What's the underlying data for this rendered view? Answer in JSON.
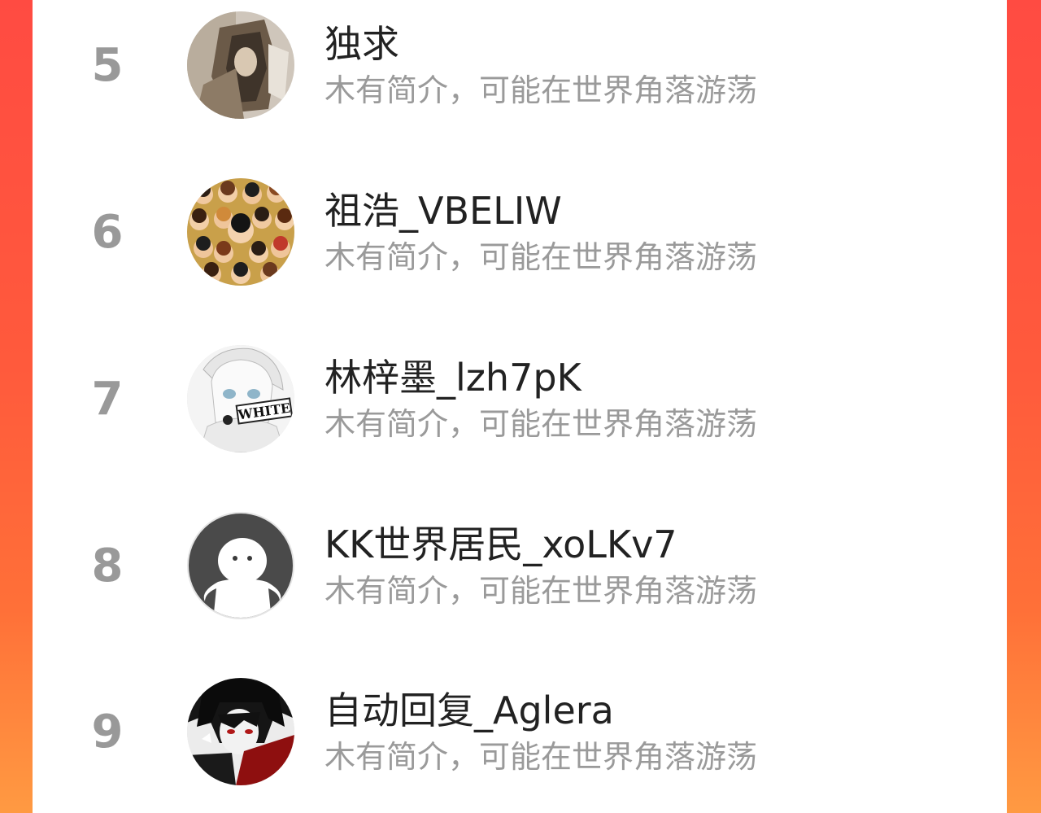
{
  "rank_list": {
    "rows": [
      {
        "rank": "5",
        "name": "独求",
        "bio": "木有简介，可能在世界角落游荡",
        "avatar_icon": "sketch-portrait-avatar"
      },
      {
        "rank": "6",
        "name": "祖浩_VBELIW",
        "bio": "木有简介，可能在世界角落游荡",
        "avatar_icon": "crowd-collage-avatar"
      },
      {
        "rank": "7",
        "name": "林梓墨_lzh7pK",
        "bio": "木有简介，可能在世界角落游荡",
        "avatar_icon": "white-anime-avatar",
        "avatar_text": "WHITE"
      },
      {
        "rank": "8",
        "name": "KK世界居民_xoLKv7",
        "bio": "木有简介，可能在世界角落游荡",
        "avatar_icon": "default-ghost-avatar"
      },
      {
        "rank": "9",
        "name": "自动回复_Aglera",
        "bio": "木有简介，可能在世界角落游荡",
        "avatar_icon": "dark-anime-avatar"
      }
    ]
  },
  "colors": {
    "background_gradient_top": "#ff4b42",
    "background_gradient_bottom": "#ff9a42",
    "panel": "#ffffff",
    "rank_number": "#999999",
    "name_text": "#222222",
    "bio_text": "#9a9a9a"
  }
}
